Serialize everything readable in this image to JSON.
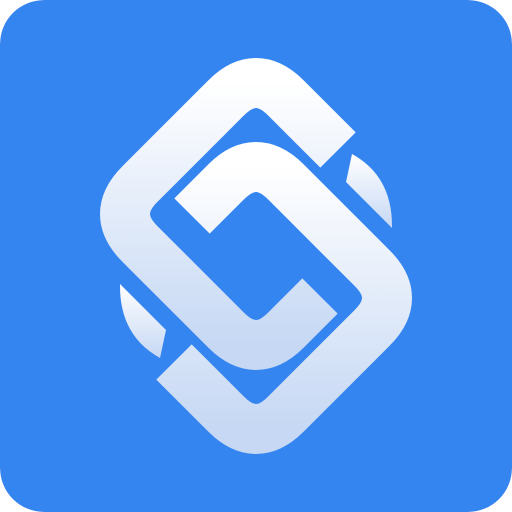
{
  "app_icon": {
    "name": "chain-link-logo",
    "icon": "interlocking-chain-links-icon",
    "colors": {
      "background": "#3585F0",
      "glyph_top": "#FFFFFF",
      "glyph_bottom": "#C6D8F4"
    }
  }
}
